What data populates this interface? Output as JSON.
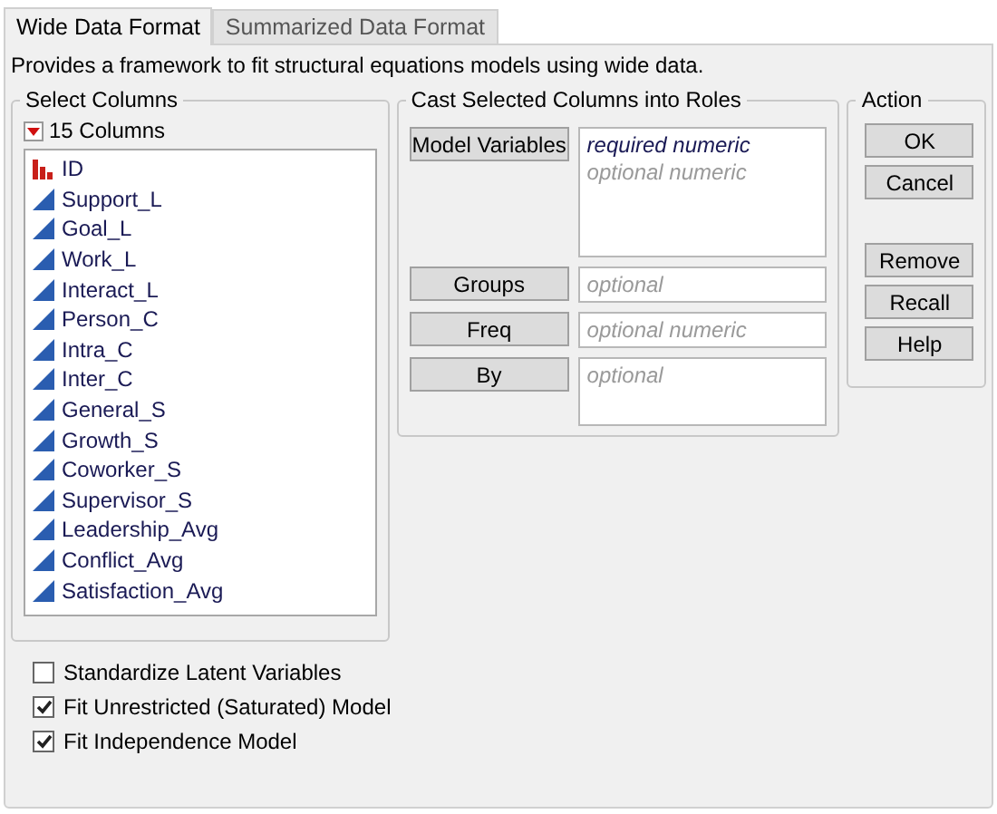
{
  "tabs": [
    {
      "label": "Wide Data Format",
      "selected": true
    },
    {
      "label": "Summarized Data Format",
      "selected": false
    }
  ],
  "description": "Provides a framework to fit structural equations models using wide data.",
  "select_columns": {
    "title": "Select Columns",
    "count_label": "15 Columns",
    "columns": [
      {
        "name": "ID",
        "kind": "nominal"
      },
      {
        "name": "Support_L",
        "kind": "continuous"
      },
      {
        "name": "Goal_L",
        "kind": "continuous"
      },
      {
        "name": "Work_L",
        "kind": "continuous"
      },
      {
        "name": "Interact_L",
        "kind": "continuous"
      },
      {
        "name": "Person_C",
        "kind": "continuous"
      },
      {
        "name": "Intra_C",
        "kind": "continuous"
      },
      {
        "name": "Inter_C",
        "kind": "continuous"
      },
      {
        "name": "General_S",
        "kind": "continuous"
      },
      {
        "name": "Growth_S",
        "kind": "continuous"
      },
      {
        "name": "Coworker_S",
        "kind": "continuous"
      },
      {
        "name": "Supervisor_S",
        "kind": "continuous"
      },
      {
        "name": "Leadership_Avg",
        "kind": "continuous"
      },
      {
        "name": "Conflict_Avg",
        "kind": "continuous"
      },
      {
        "name": "Satisfaction_Avg",
        "kind": "continuous"
      }
    ]
  },
  "roles": {
    "title": "Cast Selected Columns into Roles",
    "items": [
      {
        "button": "Model Variables",
        "kind": "tall",
        "hints": [
          {
            "text": "required numeric",
            "kind": "required"
          },
          {
            "text": "optional numeric",
            "kind": "optional"
          }
        ]
      },
      {
        "button": "Groups",
        "kind": "single",
        "hints": [
          {
            "text": "optional",
            "kind": "optional"
          }
        ]
      },
      {
        "button": "Freq",
        "kind": "single",
        "hints": [
          {
            "text": "optional numeric",
            "kind": "optional"
          }
        ]
      },
      {
        "button": "By",
        "kind": "short",
        "hints": [
          {
            "text": "optional",
            "kind": "optional"
          }
        ]
      }
    ]
  },
  "action": {
    "title": "Action",
    "button_groups": [
      [
        "OK",
        "Cancel"
      ],
      [
        "Remove",
        "Recall",
        "Help"
      ]
    ]
  },
  "options": [
    {
      "label": "Standardize Latent Variables",
      "checked": false
    },
    {
      "label": "Fit Unrestricted (Saturated) Model",
      "checked": true
    },
    {
      "label": "Fit Independence Model",
      "checked": true
    }
  ]
}
